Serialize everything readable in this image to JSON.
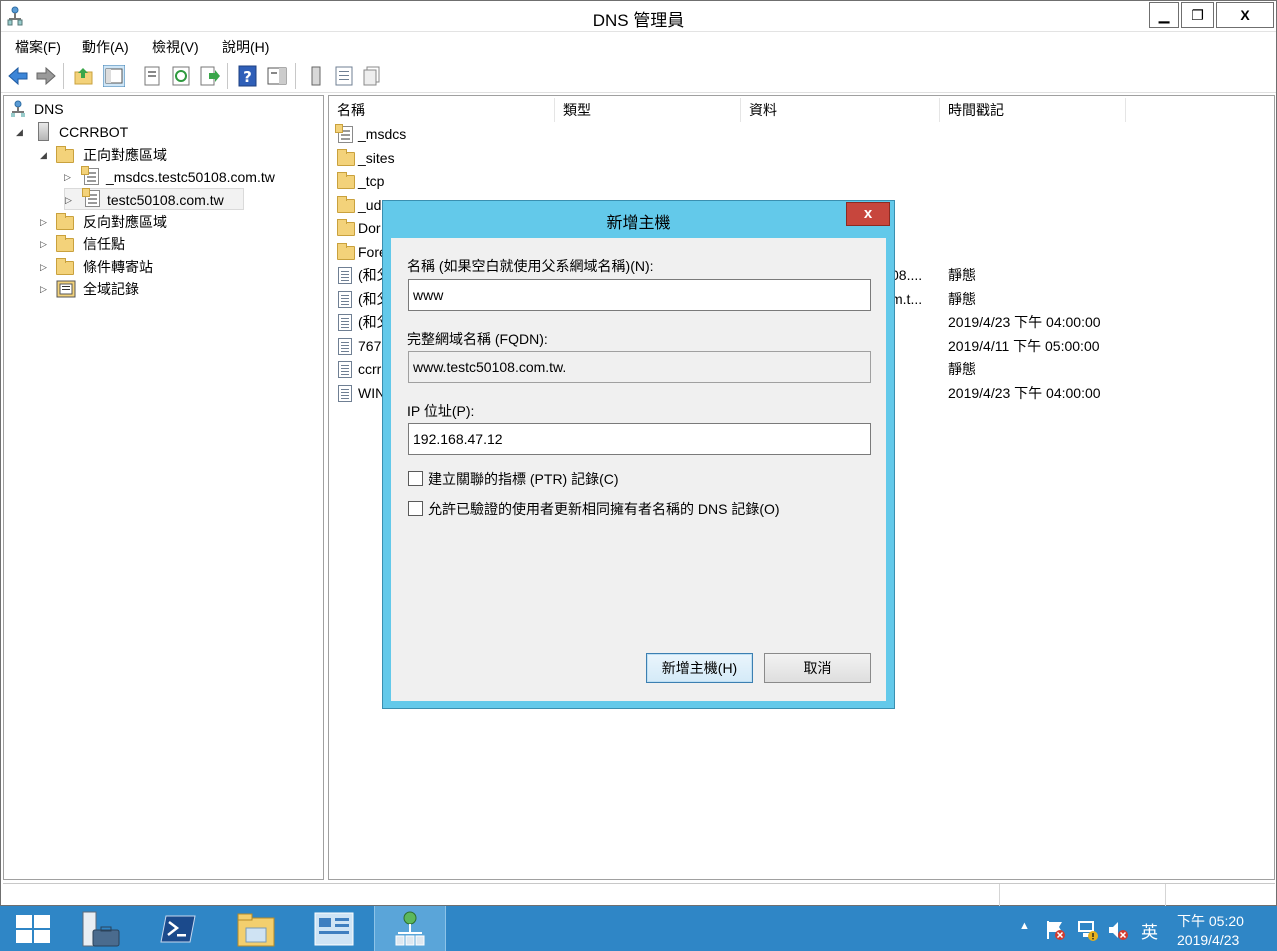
{
  "window": {
    "title": "DNS 管理員",
    "minimize": "▁",
    "restore": "❐",
    "close": "X"
  },
  "menu": [
    "檔案(F)",
    "動作(A)",
    "檢視(V)",
    "說明(H)"
  ],
  "toolbar": {
    "icons": [
      "back-icon",
      "forward-icon",
      "up-folder-icon",
      "show-hide-tree-icon",
      "properties-icon",
      "refresh-icon",
      "export-list-icon",
      "help-icon",
      "action-pane-icon",
      "server-record-icon",
      "list-icon",
      "copy-icon"
    ]
  },
  "tree": {
    "root": "DNS",
    "server": "CCRRBOT",
    "forward_zones": "正向對應區域",
    "zone_msdcs": "_msdcs.testc50108.com.tw",
    "zone_main": "testc50108.com.tw",
    "reverse_zones": "反向對應區域",
    "trust_points": "信任點",
    "conditional_forwarders": "條件轉寄站",
    "global_logs": "全域記錄"
  },
  "list": {
    "columns": [
      "名稱",
      "類型",
      "資料",
      "時間戳記"
    ],
    "rows": [
      {
        "icon": "zone-icon",
        "name": "_msdcs",
        "data_tail": "",
        "timestamp": ""
      },
      {
        "icon": "folder-icon",
        "name": "_sites",
        "data_tail": "",
        "timestamp": ""
      },
      {
        "icon": "folder-icon",
        "name": "_tcp",
        "data_tail": "",
        "timestamp": ""
      },
      {
        "icon": "folder-icon",
        "name": "_ud",
        "data_tail": "",
        "timestamp": ""
      },
      {
        "icon": "folder-icon",
        "name": "Dor",
        "data_tail": "",
        "timestamp": ""
      },
      {
        "icon": "folder-icon",
        "name": "Fore",
        "data_tail": "",
        "timestamp": ""
      },
      {
        "icon": "record-icon",
        "name": "(和父",
        "data_tail": "08....",
        "timestamp": "靜態"
      },
      {
        "icon": "record-icon",
        "name": "(和父",
        "data_tail": "m.t...",
        "timestamp": "靜態"
      },
      {
        "icon": "record-icon",
        "name": "(和父",
        "data_tail": "",
        "timestamp": "2019/4/23 下午 04:00:00"
      },
      {
        "icon": "record-icon",
        "name": "767",
        "data_tail": "",
        "timestamp": "2019/4/11 下午 05:00:00"
      },
      {
        "icon": "record-icon",
        "name": "ccrr",
        "data_tail": "",
        "timestamp": "靜態"
      },
      {
        "icon": "record-icon",
        "name": "WIN",
        "data_tail": "",
        "timestamp": "2019/4/23 下午 04:00:00"
      }
    ]
  },
  "dialog": {
    "title": "新增主機",
    "close": "x",
    "name_label": "名稱 (如果空白就使用父系網域名稱)(N):",
    "name_value": "www",
    "fqdn_label": "完整網域名稱 (FQDN):",
    "fqdn_value": "www.testc50108.com.tw.",
    "ip_label": "IP 位址(P):",
    "ip_value": "192.168.47.12",
    "ptr_checkbox": "建立關聯的指標 (PTR) 記錄(C)",
    "ptr_checked": false,
    "auth_update_checkbox": "允許已驗證的使用者更新相同擁有者名稱的 DNS 記錄(O)",
    "auth_update_checked": false,
    "add_host_button": "新增主機(H)",
    "cancel_button": "取消"
  },
  "taskbar": {
    "apps": [
      "start-icon",
      "server-manager-icon",
      "powershell-icon",
      "file-explorer-icon",
      "control-panel-icon",
      "dns-manager-icon"
    ],
    "active_app": "dns-manager-icon",
    "ime": "英",
    "time": "下午 05:20",
    "date": "2019/4/23",
    "tray_arrow": "▲"
  },
  "colors": {
    "dialog_frame": "#63c9ea",
    "taskbar": "#2f86c6",
    "close_red": "#c7463d"
  }
}
